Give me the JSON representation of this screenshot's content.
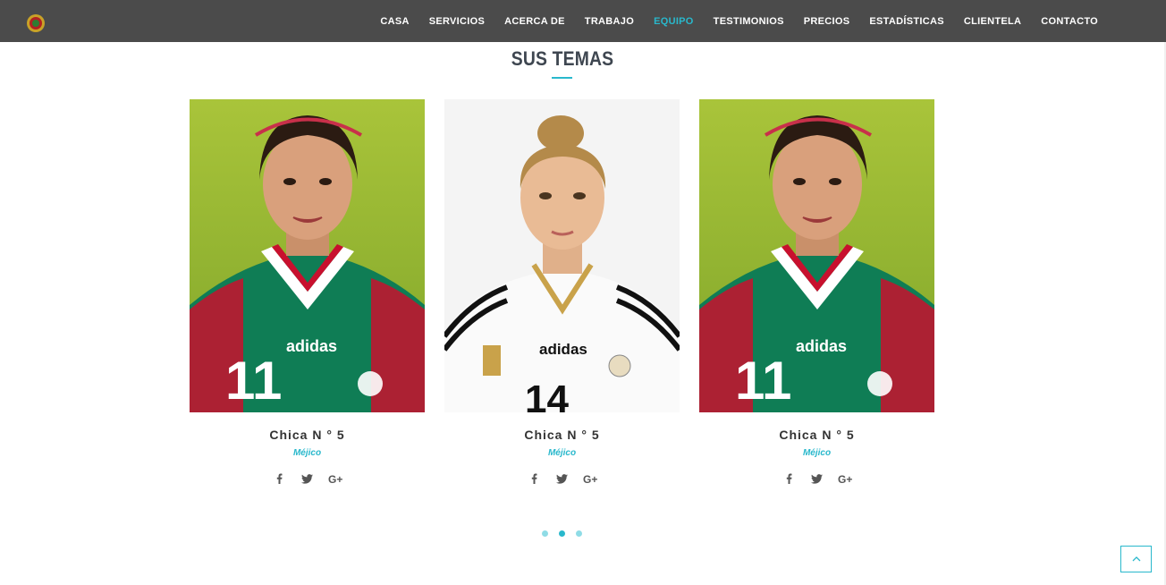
{
  "nav": {
    "items": [
      {
        "label": "CASA"
      },
      {
        "label": "SERVICIOS"
      },
      {
        "label": "ACERCA DE"
      },
      {
        "label": "TRABAJO"
      },
      {
        "label": "EQUIPO",
        "active": true
      },
      {
        "label": "TESTIMONIOS"
      },
      {
        "label": "PRECIOS"
      },
      {
        "label": "ESTADÍSTICAS"
      },
      {
        "label": "CLIENTELA"
      },
      {
        "label": "CONTACTO"
      }
    ],
    "accent": "#29b8cc",
    "background": "#4b4b4b"
  },
  "section": {
    "title": "SUS TEMAS"
  },
  "team": [
    {
      "name": "Chica N ° 5",
      "country": "Méjico",
      "jersey": "green",
      "socials": [
        "facebook-icon",
        "twitter-icon",
        "google-plus-icon"
      ]
    },
    {
      "name": "Chica N ° 5",
      "country": "Méjico",
      "jersey": "white",
      "socials": [
        "facebook-icon",
        "twitter-icon",
        "google-plus-icon"
      ]
    },
    {
      "name": "Chica N ° 5",
      "country": "Méjico",
      "jersey": "green",
      "socials": [
        "facebook-icon",
        "twitter-icon",
        "google-plus-icon"
      ]
    }
  ],
  "carousel": {
    "pages": 3,
    "active_page": 2
  },
  "icons": {
    "scroll_to_top": "chevron-up-icon"
  }
}
